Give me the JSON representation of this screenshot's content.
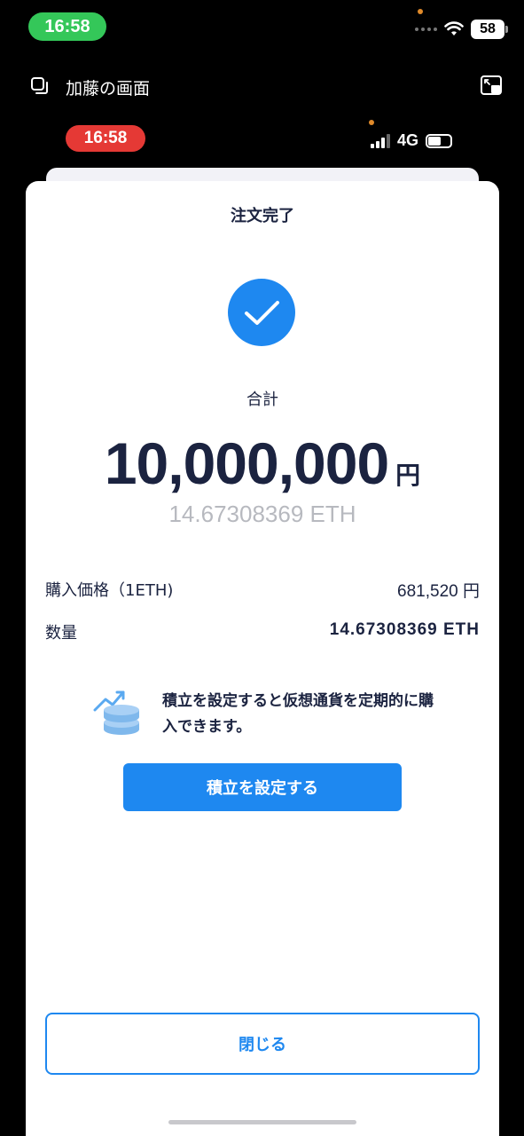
{
  "outer_status": {
    "time": "16:58",
    "battery": "58"
  },
  "share_bar": {
    "title": "加藤の画面"
  },
  "inner_status": {
    "time": "16:58",
    "network": "4G"
  },
  "order": {
    "title": "注文完了",
    "total_label": "合計",
    "total_amount": "10,000,000",
    "currency": "円",
    "eth_equivalent": "14.67308369 ETH",
    "price_label": "購入価格（1ETH)",
    "price_value": "681,520 円",
    "quantity_label": "数量",
    "quantity_value": "14.67308369 ETH"
  },
  "promo": {
    "text": "積立を設定すると仮想通貨を定期的に購入できます。",
    "button": "積立を設定する"
  },
  "close_button": "閉じる",
  "colors": {
    "accent": "#1e88f0",
    "text": "#1b2340",
    "muted": "#b7b9bf",
    "outer_time_pill": "#34c759",
    "inner_time_pill": "#e53935"
  },
  "icons": [
    "screen-share-icon",
    "wifi-icon",
    "pip-icon",
    "signal-icon",
    "battery-icon",
    "checkmark-icon",
    "chart-coins-icon"
  ]
}
